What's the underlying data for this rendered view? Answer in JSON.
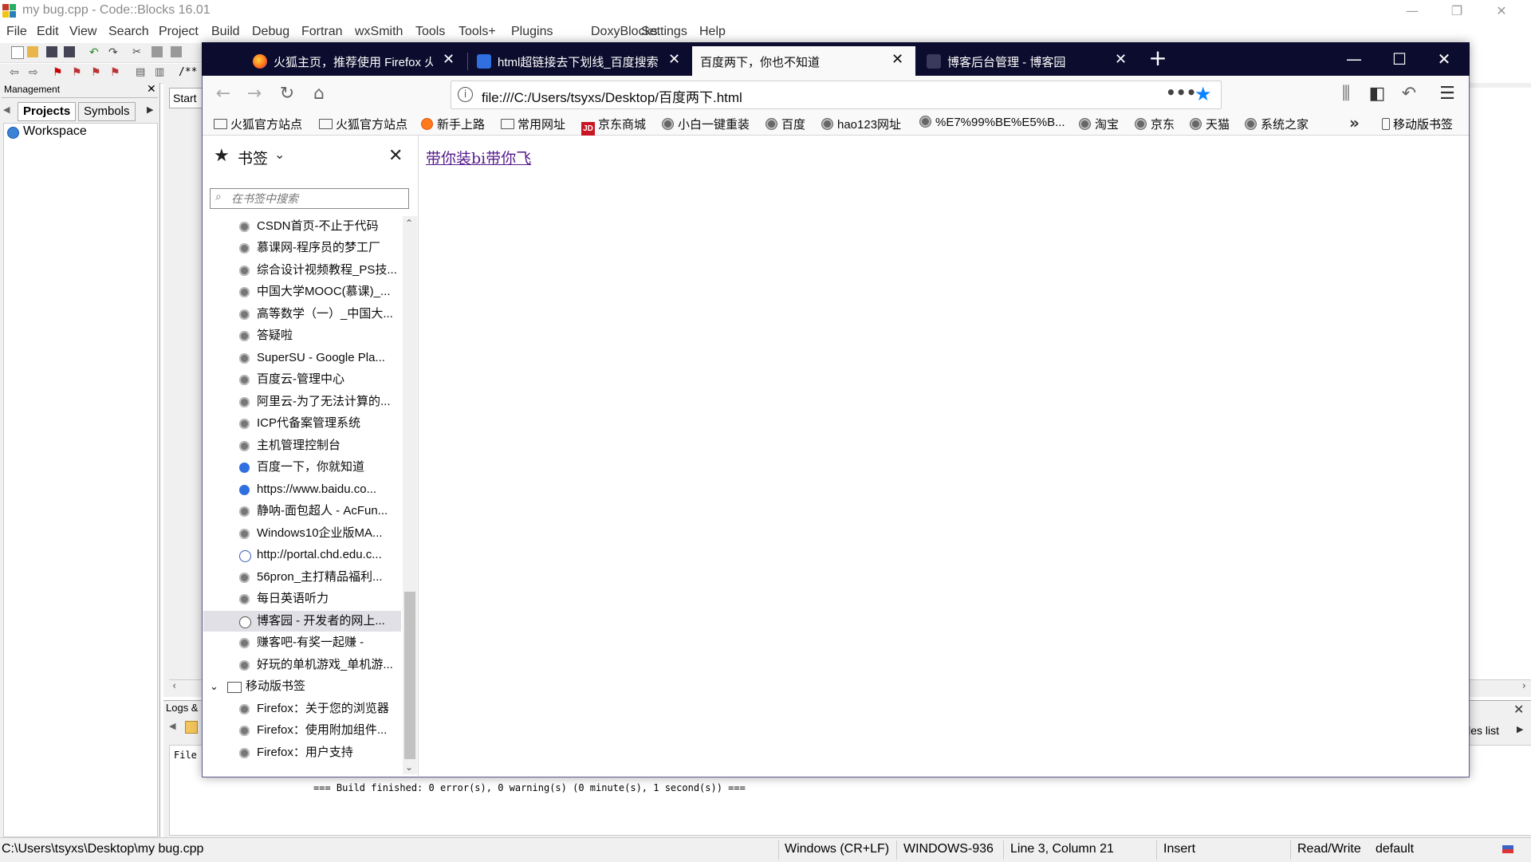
{
  "codeblocks": {
    "title": "my bug.cpp - Code::Blocks 16.01",
    "menu": [
      "File",
      "Edit",
      "View",
      "Search",
      "Project",
      "Build",
      "Debug",
      "Fortran",
      "wxSmith",
      "Tools",
      "Tools+",
      "Plugins",
      "DoxyBlocks",
      "Settings",
      "Help"
    ],
    "management": {
      "header": "Management",
      "tabs": [
        "Projects",
        "Symbols"
      ],
      "workspace": "Workspace"
    },
    "editor_tab": "Start",
    "toolbar_comment": "/** *",
    "logs": {
      "tab": "Logs &",
      "file_label": "File",
      "build_message": "=== Build finished: 0 error(s), 0 warning(s) (0 minute(s), 1 second(s)) ===",
      "files_list": "iles list"
    },
    "status": {
      "path": "C:\\Users\\tsyxs\\Desktop\\my bug.cpp",
      "line_endings": "Windows (CR+LF)",
      "encoding": "WINDOWS-936",
      "position": "Line 3, Column 21",
      "mode": "Insert",
      "access": "Read/Write",
      "profile": "default"
    }
  },
  "firefox": {
    "tabs": [
      {
        "label": "火狐主页，推荐使用 Firefox 火",
        "icon": "firefox-icon",
        "active": false
      },
      {
        "label": "html超链接去下划线_百度搜索",
        "icon": "baidu-paw-icon",
        "active": false
      },
      {
        "label": "百度两下，你也不知道",
        "icon": "",
        "active": true
      },
      {
        "label": "博客后台管理 - 博客园",
        "icon": "cnblogs-icon",
        "active": false
      }
    ],
    "url": "file:///C:/Users/tsyxs/Desktop/百度两下.html",
    "bookmarks_bar": [
      {
        "label": "火狐官方站点",
        "icon": "folder-icon"
      },
      {
        "label": "火狐官方站点",
        "icon": "folder-icon"
      },
      {
        "label": "新手上路",
        "icon": "firefox-icon"
      },
      {
        "label": "常用网址",
        "icon": "folder-icon"
      },
      {
        "label": "京东商城",
        "icon": "jd-icon"
      },
      {
        "label": "小白一键重装",
        "icon": "globe-icon"
      },
      {
        "label": "百度",
        "icon": "globe-icon"
      },
      {
        "label": "hao123网址",
        "icon": "globe-icon"
      },
      {
        "label": "%E7%99%BE%E5%B...",
        "icon": "globe-icon"
      },
      {
        "label": "淘宝",
        "icon": "globe-icon"
      },
      {
        "label": "京东",
        "icon": "globe-icon"
      },
      {
        "label": "天猫",
        "icon": "globe-icon"
      },
      {
        "label": "系统之家",
        "icon": "globe-icon"
      }
    ],
    "mobile_bookmarks_label": "移动版书签",
    "sidebar": {
      "title": "书签",
      "search_placeholder": "在书签中搜索",
      "items": [
        {
          "label": "CSDN首页-不止于代码",
          "icon": "globe-icon"
        },
        {
          "label": "慕课网-程序员的梦工厂",
          "icon": "globe-icon"
        },
        {
          "label": "综合设计视频教程_PS技...",
          "icon": "globe-icon"
        },
        {
          "label": "中国大学MOOC(慕课)_...",
          "icon": "globe-icon"
        },
        {
          "label": "高等数学（一）_中国大...",
          "icon": "globe-icon"
        },
        {
          "label": "答疑啦",
          "icon": "globe-icon"
        },
        {
          "label": "SuperSU - Google Pla...",
          "icon": "globe-icon"
        },
        {
          "label": "百度云-管理中心",
          "icon": "globe-icon"
        },
        {
          "label": "阿里云-为了无法计算的...",
          "icon": "globe-icon"
        },
        {
          "label": "ICP代备案管理系统",
          "icon": "globe-icon"
        },
        {
          "label": "主机管理控制台",
          "icon": "globe-icon"
        },
        {
          "label": "百度一下，你就知道",
          "icon": "baidu-paw-icon"
        },
        {
          "label": "https://www.baidu.co...",
          "icon": "baidu-paw-icon"
        },
        {
          "label": "静呐-面包超人 - AcFun...",
          "icon": "globe-icon"
        },
        {
          "label": "Windows10企业版MA...",
          "icon": "globe-icon"
        },
        {
          "label": "http://portal.chd.edu.c...",
          "icon": "portal-icon"
        },
        {
          "label": "56pron_主打精品福利...",
          "icon": "globe-icon"
        },
        {
          "label": "每日英语听力",
          "icon": "globe-icon"
        },
        {
          "label": "博客园 - 开发者的网上...",
          "icon": "cnblogs-icon",
          "selected": true
        },
        {
          "label": "赚客吧-有奖一起赚 -",
          "icon": "globe-icon"
        },
        {
          "label": "好玩的单机游戏_单机游...",
          "icon": "globe-icon"
        }
      ],
      "folder": {
        "label": "移动版书签",
        "icon": "folder-icon"
      },
      "folder_items": [
        {
          "label": "Firefox：关于您的浏览器",
          "icon": "globe-icon"
        },
        {
          "label": "Firefox：使用附加组件...",
          "icon": "globe-icon"
        },
        {
          "label": "Firefox：用户支持",
          "icon": "globe-icon"
        }
      ]
    },
    "page": {
      "link_text": "带你装bi带你飞"
    },
    "colors": {
      "tabbar_bg": "#0c0c2e",
      "accent": "#0a84ff",
      "visited_link": "#551a8b"
    }
  }
}
